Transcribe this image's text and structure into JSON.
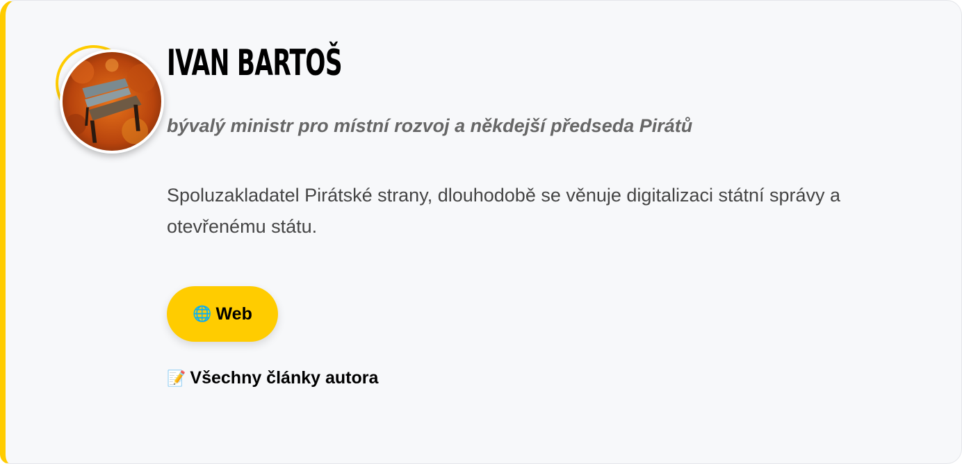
{
  "author": {
    "name": "IVAN BARTOŠ",
    "role": "bývalý ministr pro místní rozvoj a někdejší předseda Pirátů",
    "bio": "Spoluzakladatel Pirátské strany, dlouhodobě se věnuje digitalizaci státní správy a otevřenému státu.",
    "avatar_icon": "autumn-park-bench-photo"
  },
  "links": {
    "web": {
      "icon": "globe-icon",
      "glyph": "🌐",
      "label": "Web"
    },
    "all_articles": {
      "icon": "memo-icon",
      "glyph": "📝",
      "label": "Všechny články autora"
    }
  },
  "colors": {
    "accent": "#ffcc00",
    "card_background": "#f7f8fa",
    "heading": "#000000",
    "role_text": "#666666",
    "body_text": "#444444"
  }
}
